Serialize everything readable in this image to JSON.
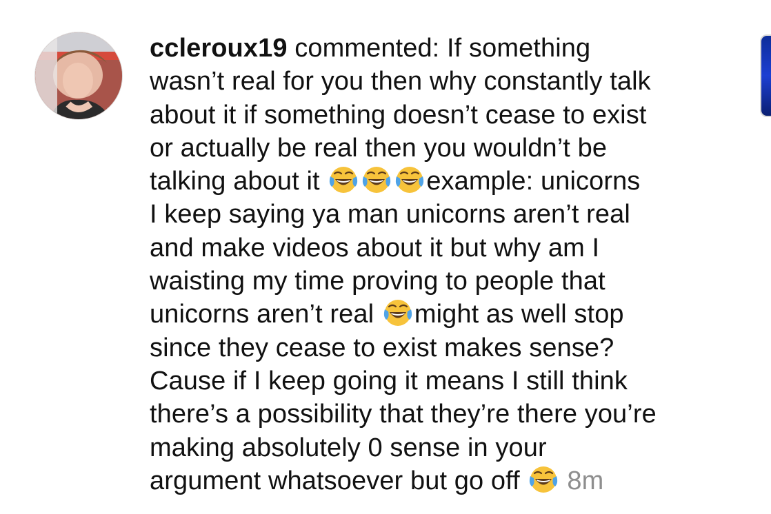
{
  "comment": {
    "username": "ccleroux19",
    "verb": "commented:",
    "lines": [
      "If something",
      "wasn’t real for you then why constantly talk",
      "about it if something doesn’t cease to exist",
      "or actually be real then you wouldn’t be",
      "talking about it",
      "example: unicorns",
      "I keep saying ya man unicorns aren’t real",
      "and make videos about it but why am I",
      "waisting my time proving to people that",
      "unicorns aren’t real",
      "might as well stop",
      "since they cease to exist makes sense?",
      "Cause if I keep going it means I still think",
      "there’s a possibility that they’re there you’re",
      "making absolutely 0 sense in your",
      "argument whatsoever but go off"
    ],
    "timestamp": "8m",
    "emoji_icon": "face-with-tears-of-joy-icon"
  },
  "avatar": {
    "icon": "user-avatar-photo"
  },
  "thumbnail": {
    "icon": "post-thumbnail",
    "color": "#1d3fd2"
  },
  "colors": {
    "text": "#111111",
    "timestamp": "#8e8e8e",
    "emoji_face": "#f7c33b"
  }
}
